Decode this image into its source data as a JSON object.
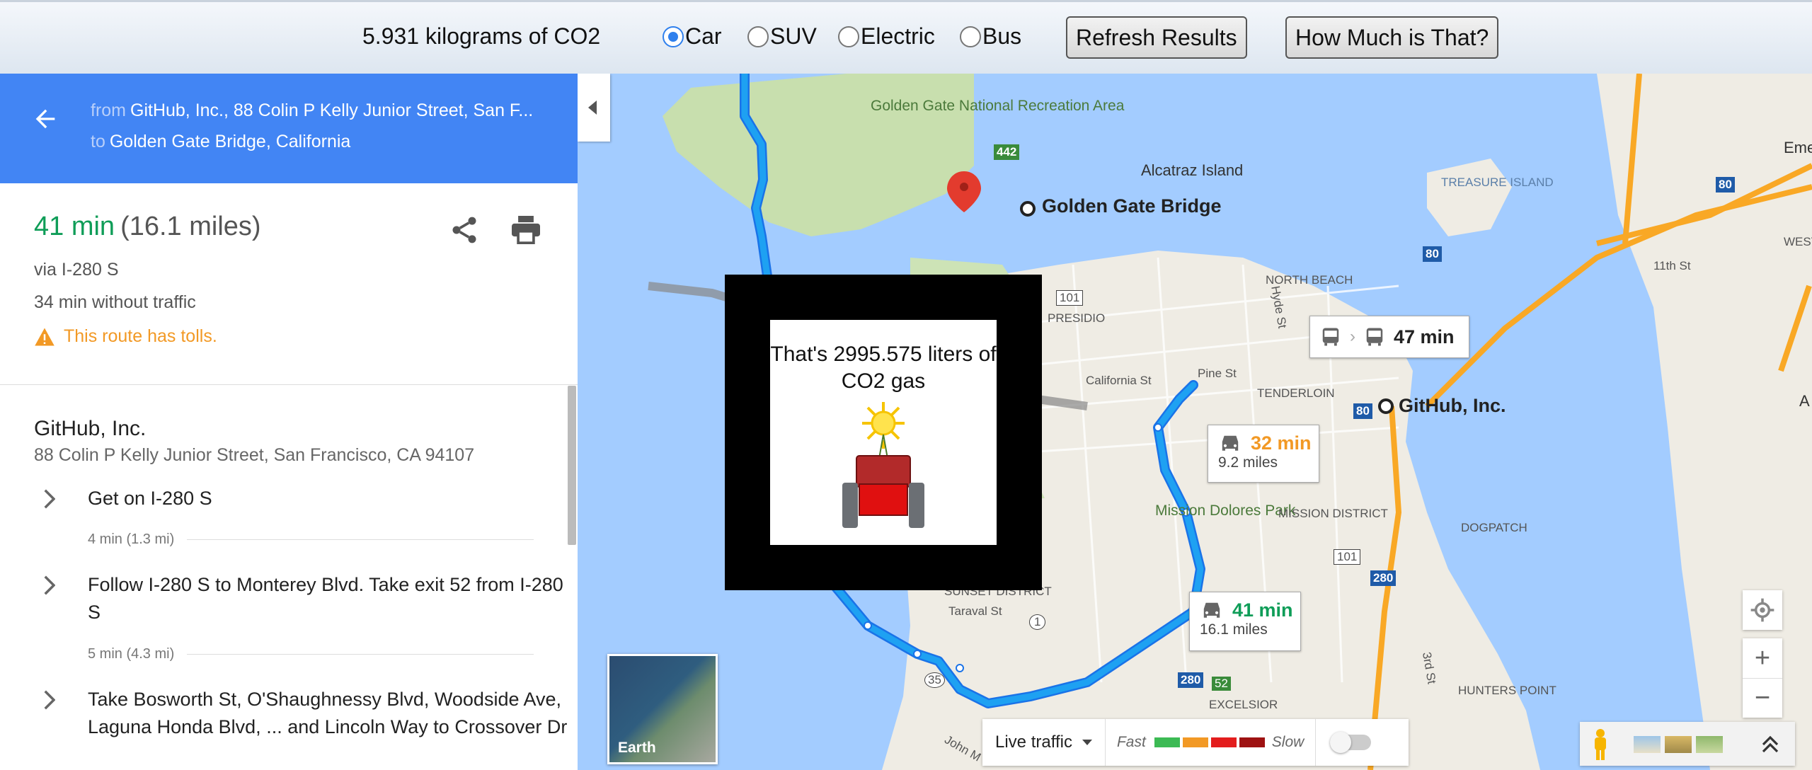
{
  "toolbar": {
    "co2_total": "5.931 kilograms of CO2",
    "vehicles": [
      {
        "label": "Car",
        "checked": true
      },
      {
        "label": "SUV",
        "checked": false
      },
      {
        "label": "Electric",
        "checked": false
      },
      {
        "label": "Bus",
        "checked": false
      }
    ],
    "refresh_label": "Refresh Results",
    "how_much_label": "How Much is That?"
  },
  "directions": {
    "from_prefix": "from",
    "from": "GitHub, Inc., 88 Colin P Kelly Junior Street, San F...",
    "to_prefix": "to",
    "to": "Golden Gate Bridge, California"
  },
  "summary": {
    "time": "41 min",
    "distance": "(16.1 miles)",
    "via": "via I-280 S",
    "without_traffic": "34 min without traffic",
    "tolls_warning": "This route has tolls."
  },
  "start": {
    "name": "GitHub, Inc.",
    "address": "88 Colin P Kelly Junior Street, San Francisco, CA 94107"
  },
  "steps": [
    {
      "text": "Get on I-280 S",
      "meta": "4 min (1.3 mi)"
    },
    {
      "text": "Follow I-280 S to Monterey Blvd. Take exit 52 from I-280 S",
      "meta": "5 min (4.3 mi)"
    },
    {
      "text": "Take Bosworth St, O'Shaughnessy Blvd, Woodside Ave, Laguna Honda Blvd, ... and Lincoln Way to Crossover Dr",
      "meta": ""
    }
  ],
  "popup": {
    "text": "That's 2995.575 liters of CO2 gas"
  },
  "map": {
    "labels": {
      "ggnra": "Golden Gate National Recreation Area",
      "alcatraz": "Alcatraz Island",
      "golden_gate": "Golden Gate Bridge",
      "github": "GitHub, Inc.",
      "treasure_island": "TREASURE ISLAND",
      "north_beach": "NORTH BEACH",
      "presidio": "PRESIDIO",
      "tenderloin": "TENDERLOIN",
      "mission_dolores": "Mission Dolores Park",
      "mission_district": "MISSION DISTRICT",
      "dogpatch": "DOGPATCH",
      "sunset": "SUNSET DISTRICT",
      "excelsior": "EXCELSIOR",
      "hunters_point": "HUNTERS POINT",
      "west_oak": "WEST OAK",
      "eme": "Eme",
      "california_st": "California St",
      "pine_st": "Pine St",
      "hyde_st": "Hyde St",
      "taraval_st": "Taraval St",
      "third_st": "3rd St",
      "eleventh_st": "11th St",
      "john_m": "John M",
      "a_edge": "A"
    },
    "shields": {
      "r442": "442",
      "r101a": "101",
      "r101b": "101",
      "r80a": "80",
      "r80b": "80",
      "r80c": "80",
      "r280a": "280",
      "r280b": "280",
      "r1": "1",
      "r35": "35",
      "r52": "52"
    },
    "transit_box": {
      "time": "47 min"
    },
    "alt_route_box": {
      "time": "32 min",
      "miles": "9.2 miles"
    },
    "main_route_box": {
      "time": "41 min",
      "miles": "16.1 miles"
    },
    "earth_label": "Earth",
    "traffic": {
      "live": "Live traffic",
      "fast": "Fast",
      "slow": "Slow"
    },
    "colors": {
      "fast": "#3cba54",
      "medium": "#f29925",
      "slow": "#e31d1d",
      "very_slow": "#9e1212",
      "route": "#1ea1f2"
    }
  }
}
